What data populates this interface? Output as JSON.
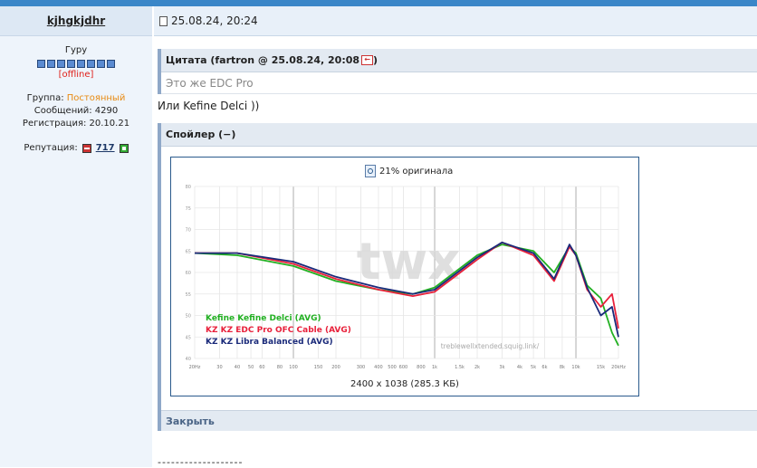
{
  "sidebar": {
    "username": "kjhgkjdhr",
    "rank": "Гуру",
    "rank_level": 8,
    "status": "[offline]",
    "group_label": "Группа:",
    "group_value": "Постоянный",
    "posts": "Сообщений: 4290",
    "registered": "Регистрация: 20.10.21",
    "reputation_label": "Репутация:",
    "reputation_value": "717"
  },
  "post": {
    "date": "25.08.24, 20:24",
    "quote_header": "Цитата (fartron @ 25.08.24, 20:08",
    "quote_header_close": ")",
    "quote_text": "Это же EDC Pro",
    "reply_text": "Или Kefine Delci ))",
    "spoiler_header": "Спойлер (−)",
    "spoiler_close": "Закрыть",
    "image_zoom": "21% оригинала",
    "image_dims": "2400 x 1038 (285.3 КБ)",
    "signature": "-------------------"
  },
  "chart_data": {
    "type": "line",
    "xscale": "log",
    "xlim": [
      20,
      20000
    ],
    "x_ticks": [
      "20Hz",
      "30",
      "40",
      "50",
      "60",
      "80",
      "100",
      "150",
      "200",
      "300",
      "400",
      "500",
      "600",
      "800",
      "1k",
      "1.5k",
      "2k",
      "3k",
      "4k",
      "5k",
      "6k",
      "8k",
      "10k",
      "15k",
      "20kHz"
    ],
    "y_ticks": [
      "80",
      "75",
      "70",
      "65",
      "60",
      "55",
      "50",
      "45",
      "40"
    ],
    "ylim": [
      40,
      80
    ],
    "watermark": "treblewellxtended.squig.link/",
    "logo": "twx",
    "series": [
      {
        "name": "Kefine Kefine Delci (AVG)",
        "color": "#22b022",
        "points": [
          [
            20,
            64.5
          ],
          [
            40,
            64.0
          ],
          [
            100,
            61.5
          ],
          [
            200,
            58.0
          ],
          [
            400,
            56.0
          ],
          [
            700,
            55.0
          ],
          [
            1000,
            56.5
          ],
          [
            2000,
            64.0
          ],
          [
            3000,
            66.5
          ],
          [
            5000,
            65.0
          ],
          [
            7000,
            60.0
          ],
          [
            9000,
            66.0
          ],
          [
            10000,
            64.5
          ],
          [
            12000,
            57.0
          ],
          [
            15000,
            54.0
          ],
          [
            18000,
            46.0
          ],
          [
            20000,
            43.0
          ]
        ]
      },
      {
        "name": "KZ KZ EDC Pro OFC Cable (AVG)",
        "color": "#e8203a",
        "points": [
          [
            20,
            64.5
          ],
          [
            40,
            64.5
          ],
          [
            100,
            62.0
          ],
          [
            200,
            58.5
          ],
          [
            400,
            56.0
          ],
          [
            700,
            54.5
          ],
          [
            1000,
            55.5
          ],
          [
            2000,
            63.0
          ],
          [
            3000,
            67.0
          ],
          [
            5000,
            64.0
          ],
          [
            7000,
            58.0
          ],
          [
            9000,
            66.0
          ],
          [
            10000,
            64.0
          ],
          [
            12000,
            56.0
          ],
          [
            15000,
            52.0
          ],
          [
            18000,
            55.0
          ],
          [
            20000,
            47.0
          ]
        ]
      },
      {
        "name": "KZ KZ Libra Balanced (AVG)",
        "color": "#1a2a7a",
        "points": [
          [
            20,
            64.5
          ],
          [
            40,
            64.5
          ],
          [
            100,
            62.5
          ],
          [
            200,
            59.0
          ],
          [
            400,
            56.5
          ],
          [
            700,
            55.0
          ],
          [
            1000,
            56.0
          ],
          [
            2000,
            63.5
          ],
          [
            3000,
            67.0
          ],
          [
            5000,
            64.5
          ],
          [
            7000,
            58.5
          ],
          [
            9000,
            66.5
          ],
          [
            10000,
            64.0
          ],
          [
            12000,
            56.5
          ],
          [
            15000,
            50.0
          ],
          [
            18000,
            52.0
          ],
          [
            20000,
            45.0
          ]
        ]
      }
    ]
  }
}
